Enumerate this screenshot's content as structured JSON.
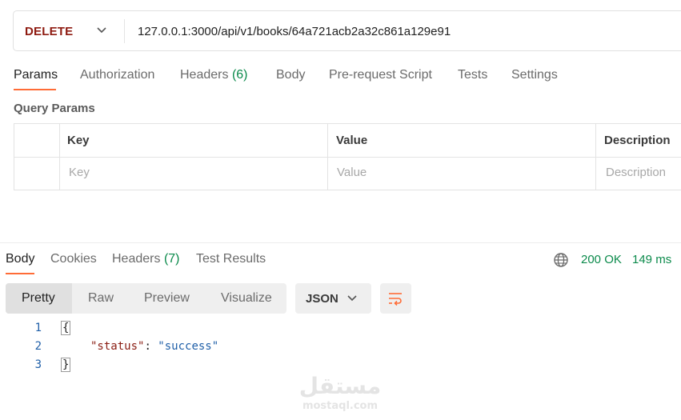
{
  "request": {
    "method": "DELETE",
    "url": "127.0.0.1:3000/api/v1/books/64a721acb2a32c861a129e91",
    "tabs": [
      {
        "label": "Params",
        "count": ""
      },
      {
        "label": "Authorization",
        "count": ""
      },
      {
        "label": "Headers",
        "count": "(6)"
      },
      {
        "label": "Body",
        "count": ""
      },
      {
        "label": "Pre-request Script",
        "count": ""
      },
      {
        "label": "Tests",
        "count": ""
      },
      {
        "label": "Settings",
        "count": ""
      }
    ],
    "active_tab": "Params",
    "query_params": {
      "title": "Query Params",
      "headers": [
        "Key",
        "Value",
        "Description"
      ],
      "placeholders": [
        "Key",
        "Value",
        "Description"
      ]
    }
  },
  "response": {
    "tabs": [
      {
        "label": "Body",
        "count": ""
      },
      {
        "label": "Cookies",
        "count": ""
      },
      {
        "label": "Headers",
        "count": "(7)"
      },
      {
        "label": "Test Results",
        "count": ""
      }
    ],
    "active_tab": "Body",
    "status": "200 OK",
    "time": "149 ms",
    "formats": [
      "Pretty",
      "Raw",
      "Preview",
      "Visualize"
    ],
    "active_format": "Pretty",
    "language": "JSON",
    "lines": {
      "n1": "1",
      "n2": "2",
      "n3": "3",
      "open": "{",
      "key": "\"status\"",
      "colon": ": ",
      "value": "\"success\"",
      "close": "}"
    }
  },
  "watermark": {
    "arabic": "مستقل",
    "latin": "mostaql.com"
  },
  "colors": {
    "accent": "#ff6c37",
    "method": "#8e1a10",
    "success": "#0b8a4b",
    "json_string": "#1f5fa8",
    "json_key": "#8a1c12"
  },
  "icons": [
    "chevron-down-icon",
    "globe-icon",
    "wrap-lines-icon"
  ]
}
